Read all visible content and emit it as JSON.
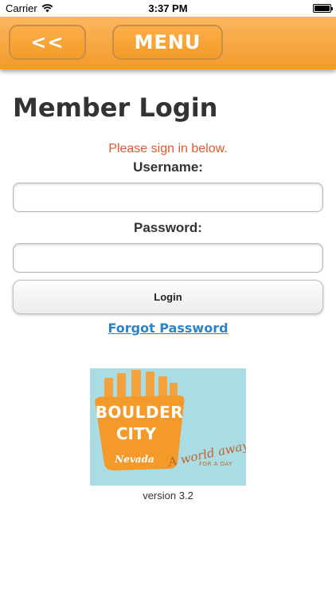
{
  "status_bar": {
    "carrier": "Carrier",
    "time": "3:37 PM",
    "wifi_icon": "wifi-icon",
    "battery_icon": "battery-icon"
  },
  "header": {
    "back_label": "<<",
    "menu_label": "MENU",
    "color": "#f5a33a"
  },
  "main": {
    "title": "Member Login",
    "message": "Please sign in below.",
    "message_color": "#e0582f",
    "username_label": "Username:",
    "username_value": "",
    "password_label": "Password:",
    "password_value": "",
    "login_label": "Login",
    "forgot_label": "Forgot Password",
    "link_color": "#2a84c6"
  },
  "logo": {
    "line1": "BOULDER",
    "line2": "CITY",
    "state": "Nevada",
    "tagline": "A world away",
    "tagline2": "FOR A DAY"
  },
  "footer": {
    "version": "version 3.2"
  }
}
